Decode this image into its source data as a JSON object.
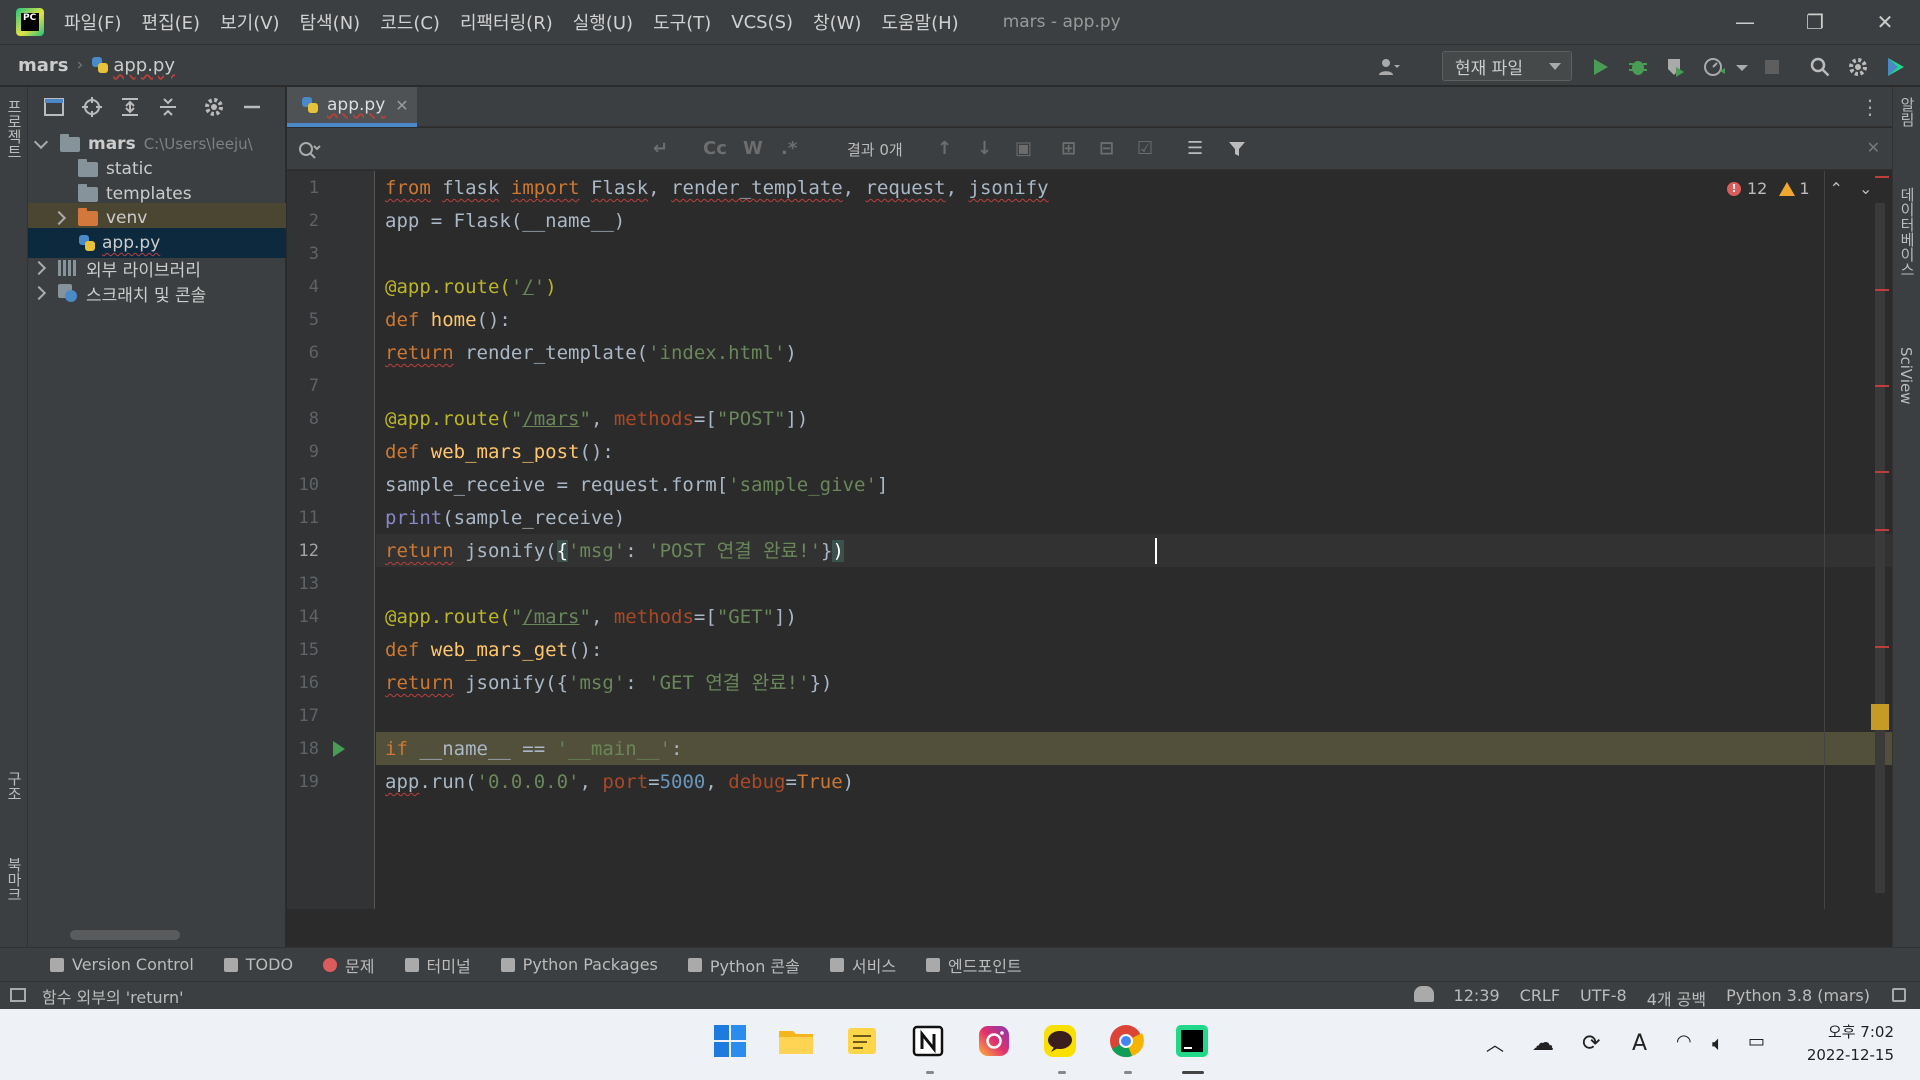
{
  "titlebar": {
    "menu": [
      "파일(F)",
      "편집(E)",
      "보기(V)",
      "탐색(N)",
      "코드(C)",
      "리팩터링(R)",
      "실행(U)",
      "도구(T)",
      "VCS(S)",
      "창(W)",
      "도움말(H)"
    ],
    "window_title": "mars - app.py",
    "minimize": "—",
    "restore": "❐",
    "close": "✕"
  },
  "navbar": {
    "project": "mars",
    "file": "app.py",
    "run_config": "현재 파일"
  },
  "left_stripe": {
    "project_label": "프로젝트",
    "structure_label": "구조",
    "bookmarks_label": "북마크"
  },
  "right_stripe": {
    "notifications_label": "알림",
    "database_label": "데이터베이스",
    "sciview_label": "SciView"
  },
  "project_tree": {
    "root": "mars",
    "root_path": "C:\\Users\\leeju\\",
    "static": "static",
    "templates": "templates",
    "venv": "venv",
    "app_file": "app.py",
    "external_libs": "외부 라이브러리",
    "scratches": "스크래치 및 콘솔"
  },
  "editor": {
    "tab_label": "app.py",
    "find_results": "결과 0개",
    "find_cc": "Cc",
    "find_w": "W",
    "find_regex": ".*",
    "errors": "12",
    "warnings": "1",
    "line_numbers": [
      "1",
      "2",
      "3",
      "4",
      "5",
      "6",
      "7",
      "8",
      "9",
      "10",
      "11",
      "12",
      "13",
      "14",
      "15",
      "16",
      "17",
      "18",
      "19"
    ]
  },
  "bottom_tools": [
    "Version Control",
    "TODO",
    "문제",
    "터미널",
    "Python Packages",
    "Python 콘솔",
    "서비스",
    "엔드포인트"
  ],
  "statusbar": {
    "message": "함수 외부의 'return'",
    "position": "12:39",
    "line_sep": "CRLF",
    "encoding": "UTF-8",
    "indent": "4개 공백",
    "interpreter": "Python 3.8 (mars)"
  },
  "taskbar": {
    "time": "오후 7:02",
    "date": "2022-12-15",
    "ime": "A"
  },
  "colors": {
    "keyword": "#cc7832",
    "function": "#ffc66d",
    "string": "#6a8759",
    "decorator": "#bbb529",
    "number": "#6897bb",
    "error": "#bc3f3c",
    "accent": "#4a88c7"
  }
}
